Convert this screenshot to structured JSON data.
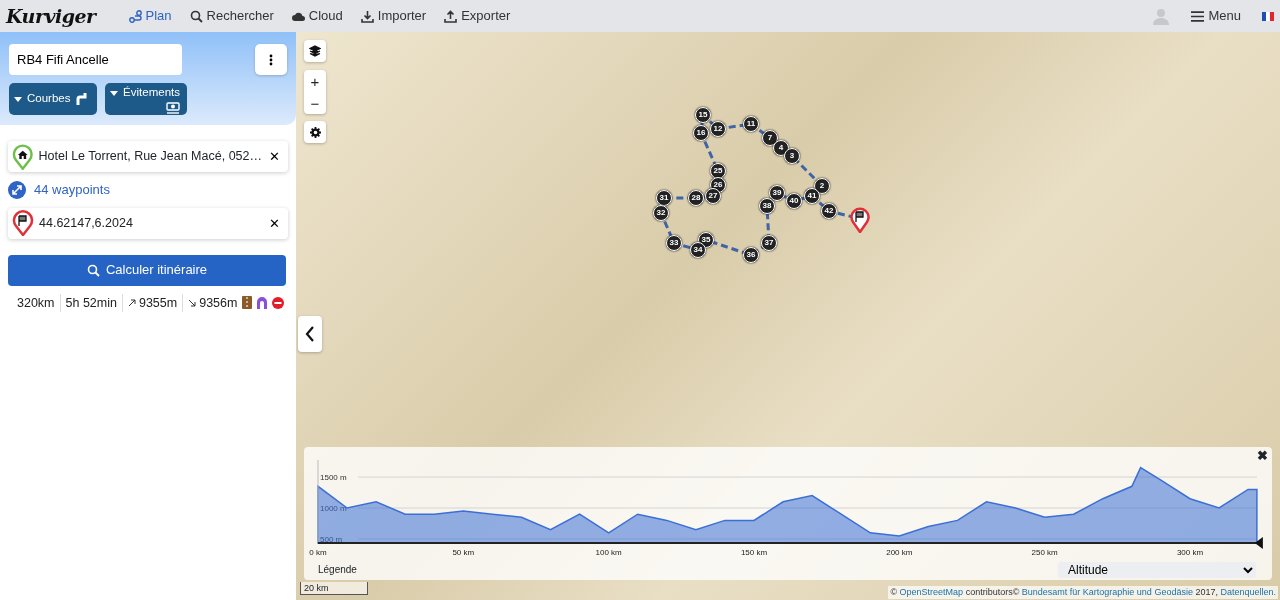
{
  "app": {
    "logo": "Kurviger"
  },
  "nav": [
    {
      "label": "Plan",
      "selected": true
    },
    {
      "label": "Rechercher",
      "selected": false
    },
    {
      "label": "Cloud",
      "selected": false
    },
    {
      "label": "Importer",
      "selected": false
    },
    {
      "label": "Exporter",
      "selected": false
    }
  ],
  "user_menu": {
    "label": "Menu"
  },
  "route": {
    "name": "RB4 Fifi Ancelle"
  },
  "options": [
    {
      "label": "Courbes"
    },
    {
      "label": "Évitements"
    }
  ],
  "start": {
    "value": "Hotel Le Torrent, Rue Jean Macé, 052…",
    "clear": "✕"
  },
  "waypoints": {
    "label": "44 waypoints"
  },
  "destination": {
    "value": "44.62147,6.2024",
    "clear": "✕"
  },
  "calculate": {
    "label": "Calculer itinéraire"
  },
  "summary": {
    "distance": "320km",
    "duration": "5h 52min",
    "ascent": "9355m",
    "descent": "9356m"
  },
  "map": {
    "zoom_in": "+",
    "zoom_out": "−",
    "markers": [
      {
        "label": "15"
      },
      {
        "label": "11"
      },
      {
        "label": "12"
      },
      {
        "label": "16"
      },
      {
        "label": "7"
      },
      {
        "label": "4"
      },
      {
        "label": "3"
      },
      {
        "label": "25"
      },
      {
        "label": "26"
      },
      {
        "label": "2"
      },
      {
        "label": "39"
      },
      {
        "label": "27"
      },
      {
        "label": "41"
      },
      {
        "label": "31"
      },
      {
        "label": "28"
      },
      {
        "label": "40"
      },
      {
        "label": "38"
      },
      {
        "label": "32"
      },
      {
        "label": "42"
      },
      {
        "label": "35"
      },
      {
        "label": "33"
      },
      {
        "label": "37"
      },
      {
        "label": "34"
      },
      {
        "label": "36"
      }
    ],
    "scale": "20 km",
    "attribution": [
      {
        "text": "© ",
        "link": false
      },
      {
        "text": "OpenStreetMap",
        "link": true
      },
      {
        "text": " contributors© ",
        "link": false
      },
      {
        "text": "Bundesamt für Kartographie und Geodäsie",
        "link": true
      },
      {
        "text": " 2017, ",
        "link": false
      },
      {
        "text": "Datenquellen.",
        "link": true
      }
    ]
  },
  "elevation": {
    "legend": "Légende",
    "close": "✖",
    "chart_data": {
      "type": "area",
      "grid": true,
      "xlim": [
        0,
        323
      ],
      "ylim": [
        435,
        1775
      ],
      "xticks": [
        {
          "value": 0,
          "label": "0 km"
        },
        {
          "value": 50,
          "label": "50 km"
        },
        {
          "value": 100,
          "label": "100 km"
        },
        {
          "value": 150,
          "label": "150 km"
        },
        {
          "value": 200,
          "label": "200 km"
        },
        {
          "value": 250,
          "label": "250 km"
        },
        {
          "value": 300,
          "label": "300 km"
        }
      ],
      "yticks": [
        {
          "value": 500,
          "label": "500 m"
        },
        {
          "value": 1000,
          "label": "1000 m"
        },
        {
          "value": 1500,
          "label": "1500 m"
        }
      ],
      "x": [
        0,
        10,
        20,
        30,
        40,
        50,
        60,
        70,
        80,
        90,
        100,
        110,
        120,
        130,
        140,
        150,
        160,
        170,
        180,
        190,
        200,
        210,
        220,
        230,
        240,
        250,
        260,
        270,
        280,
        283,
        290,
        300,
        310,
        320,
        323
      ],
      "series": [
        {
          "name": "Altitude",
          "color": "#3b6fd6",
          "values": [
            1350,
            1000,
            1100,
            900,
            900,
            950,
            900,
            850,
            650,
            900,
            600,
            900,
            800,
            650,
            800,
            800,
            1100,
            1200,
            900,
            600,
            550,
            700,
            800,
            1100,
            1000,
            850,
            900,
            1150,
            1350,
            1650,
            1450,
            1150,
            1000,
            1300,
            1300
          ]
        }
      ]
    }
  }
}
